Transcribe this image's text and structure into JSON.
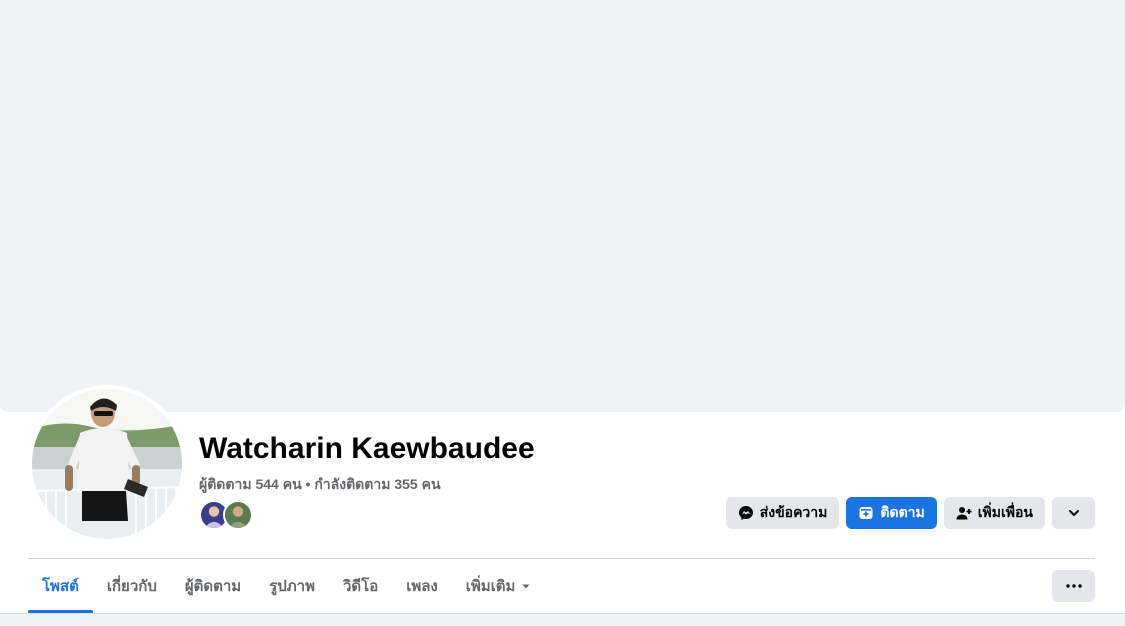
{
  "profile": {
    "name": "Watcharin Kaewbaudee",
    "stats": "ผู้ติดตาม 544 คน • กำลังติดตาม 355 คน"
  },
  "actions": {
    "message": "ส่งข้อความ",
    "follow": "ติดตาม",
    "add_friend": "เพิ่มเพื่อน",
    "more_icon": "chevron-down-icon"
  },
  "tabs": [
    {
      "label": "โพสต์",
      "active": true
    },
    {
      "label": "เกี่ยวกับ",
      "active": false
    },
    {
      "label": "ผู้ติดตาม",
      "active": false
    },
    {
      "label": "รูปภาพ",
      "active": false
    },
    {
      "label": "วิดีโอ",
      "active": false
    },
    {
      "label": "เพลง",
      "active": false
    },
    {
      "label": "เพิ่มเติม",
      "active": false
    }
  ],
  "colors": {
    "accent": "#1b74e4",
    "cover": "#f0f2f5",
    "button_bg": "#e4e6eb",
    "secondary_text": "#65676b"
  }
}
